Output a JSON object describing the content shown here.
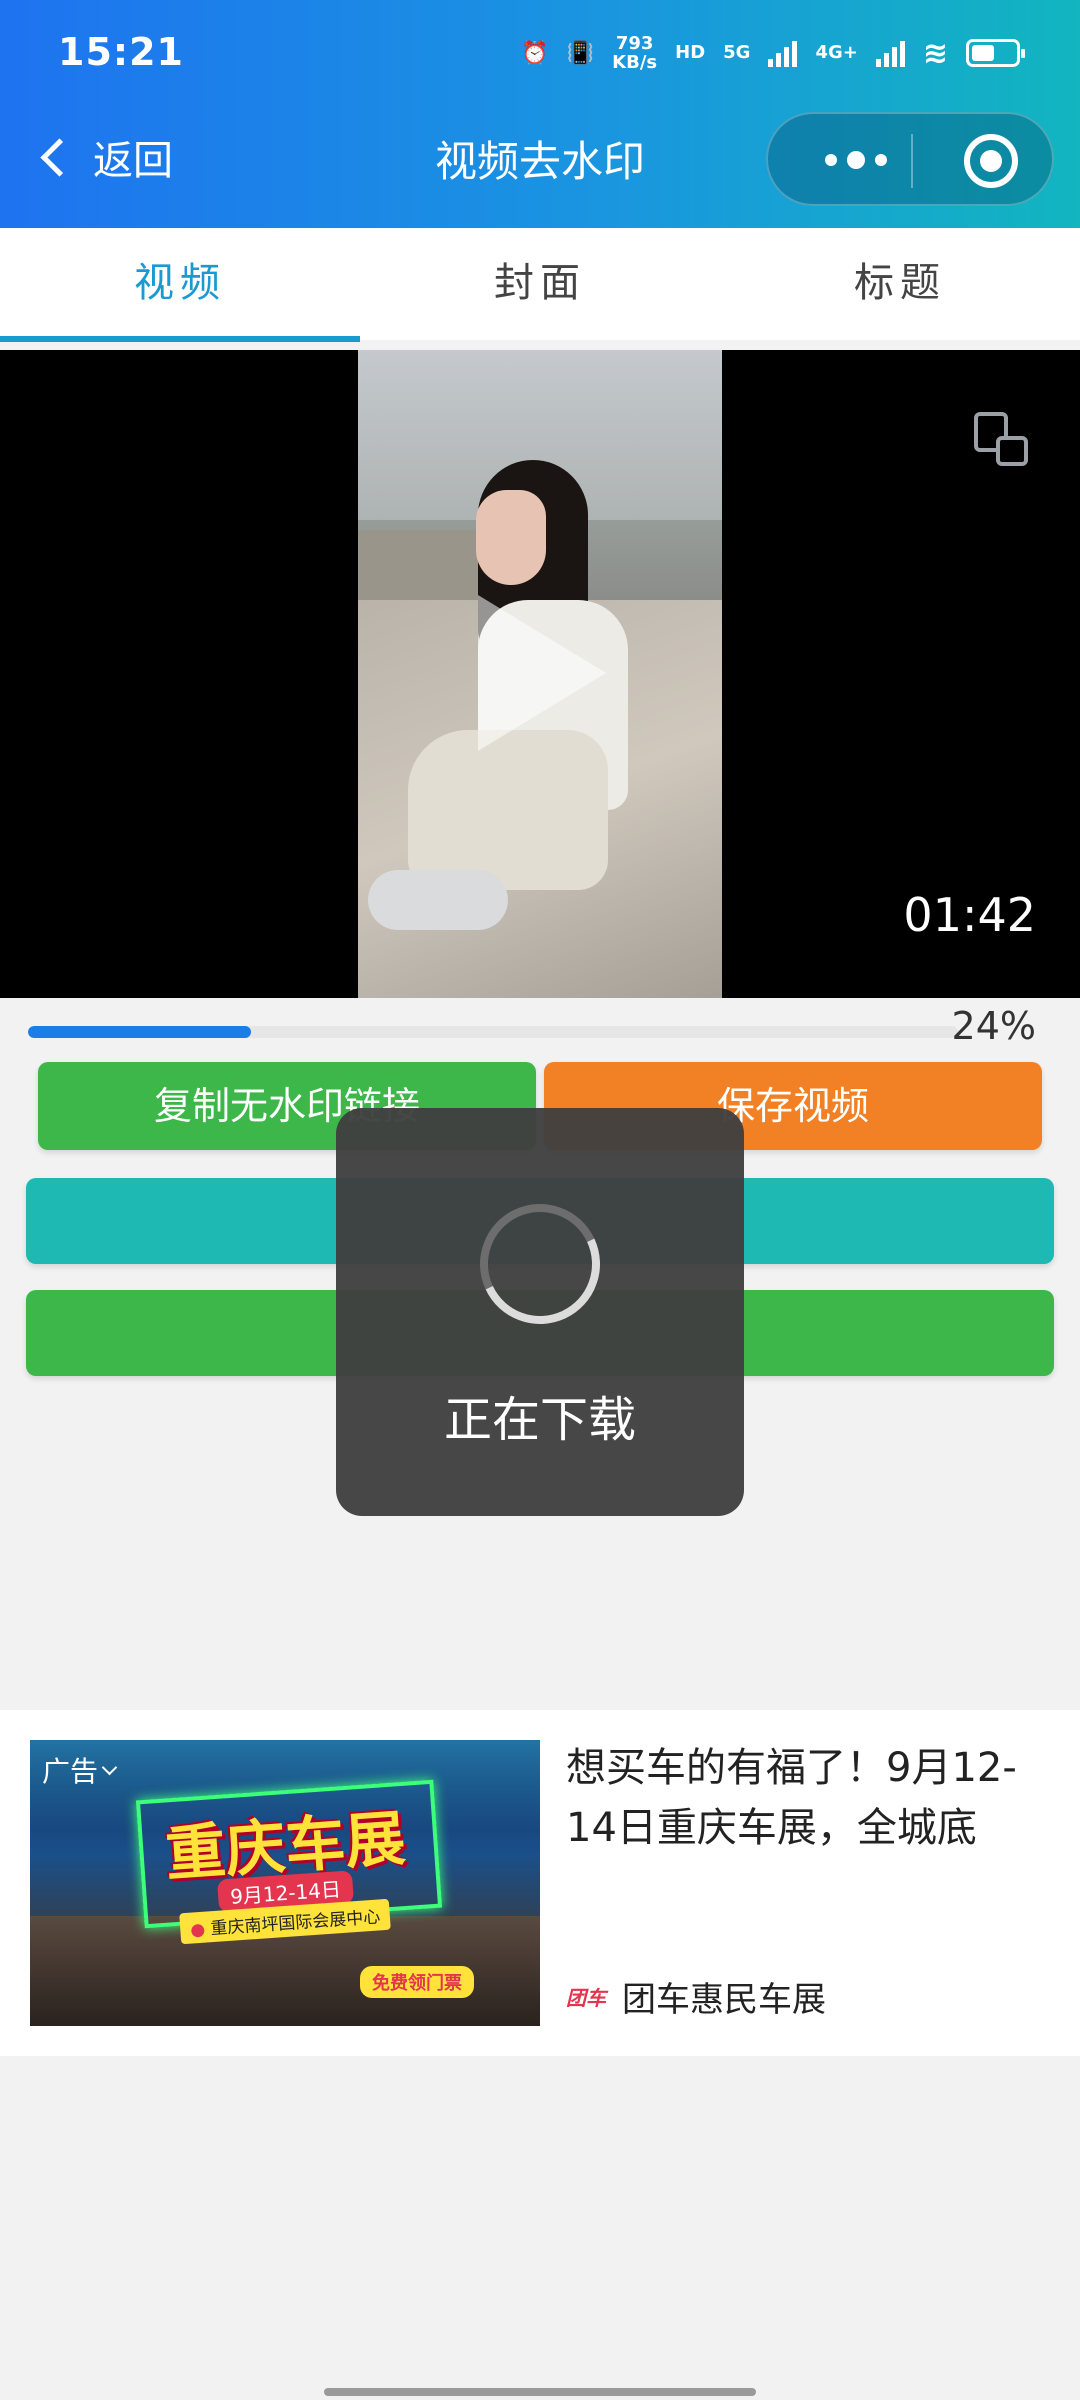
{
  "status_bar": {
    "time": "15:21",
    "net_speed_value": "793",
    "net_speed_unit": "KB/s",
    "hd_label": "HD",
    "sig1": "5G",
    "sig2": "4G+",
    "icons": [
      "alarm-icon",
      "vibrate-icon",
      "hd-icon",
      "signal-icon",
      "wifi-icon",
      "battery-icon"
    ]
  },
  "nav": {
    "back_label": "返回",
    "title": "视频去水印"
  },
  "tabs": [
    {
      "label": "视频",
      "active": true
    },
    {
      "label": "封面",
      "active": false
    },
    {
      "label": "标题",
      "active": false
    }
  ],
  "video": {
    "duration": "01:42"
  },
  "progress": {
    "percent": 24,
    "text": "24%"
  },
  "buttons": {
    "copy_label": "复制无水印链接",
    "save_label": "保存视频"
  },
  "toast": {
    "text": "正在下载"
  },
  "ad": {
    "tag": "广告",
    "image_headline": "重庆车展",
    "image_date": "9月12-14日",
    "image_venue": "重庆南坪国际会展中心",
    "image_ticket": "免费领门票",
    "title": "想买车的有福了！9月12-14日重庆车展，全城底",
    "brand_logo": "团车",
    "brand_name": "团车惠民车展"
  },
  "colors": {
    "accent": "#1a9ad0",
    "copy_button": "#3db64a",
    "save_button": "#f28024",
    "teal_button": "#1db9b2",
    "progress": "#1a7ee6"
  }
}
